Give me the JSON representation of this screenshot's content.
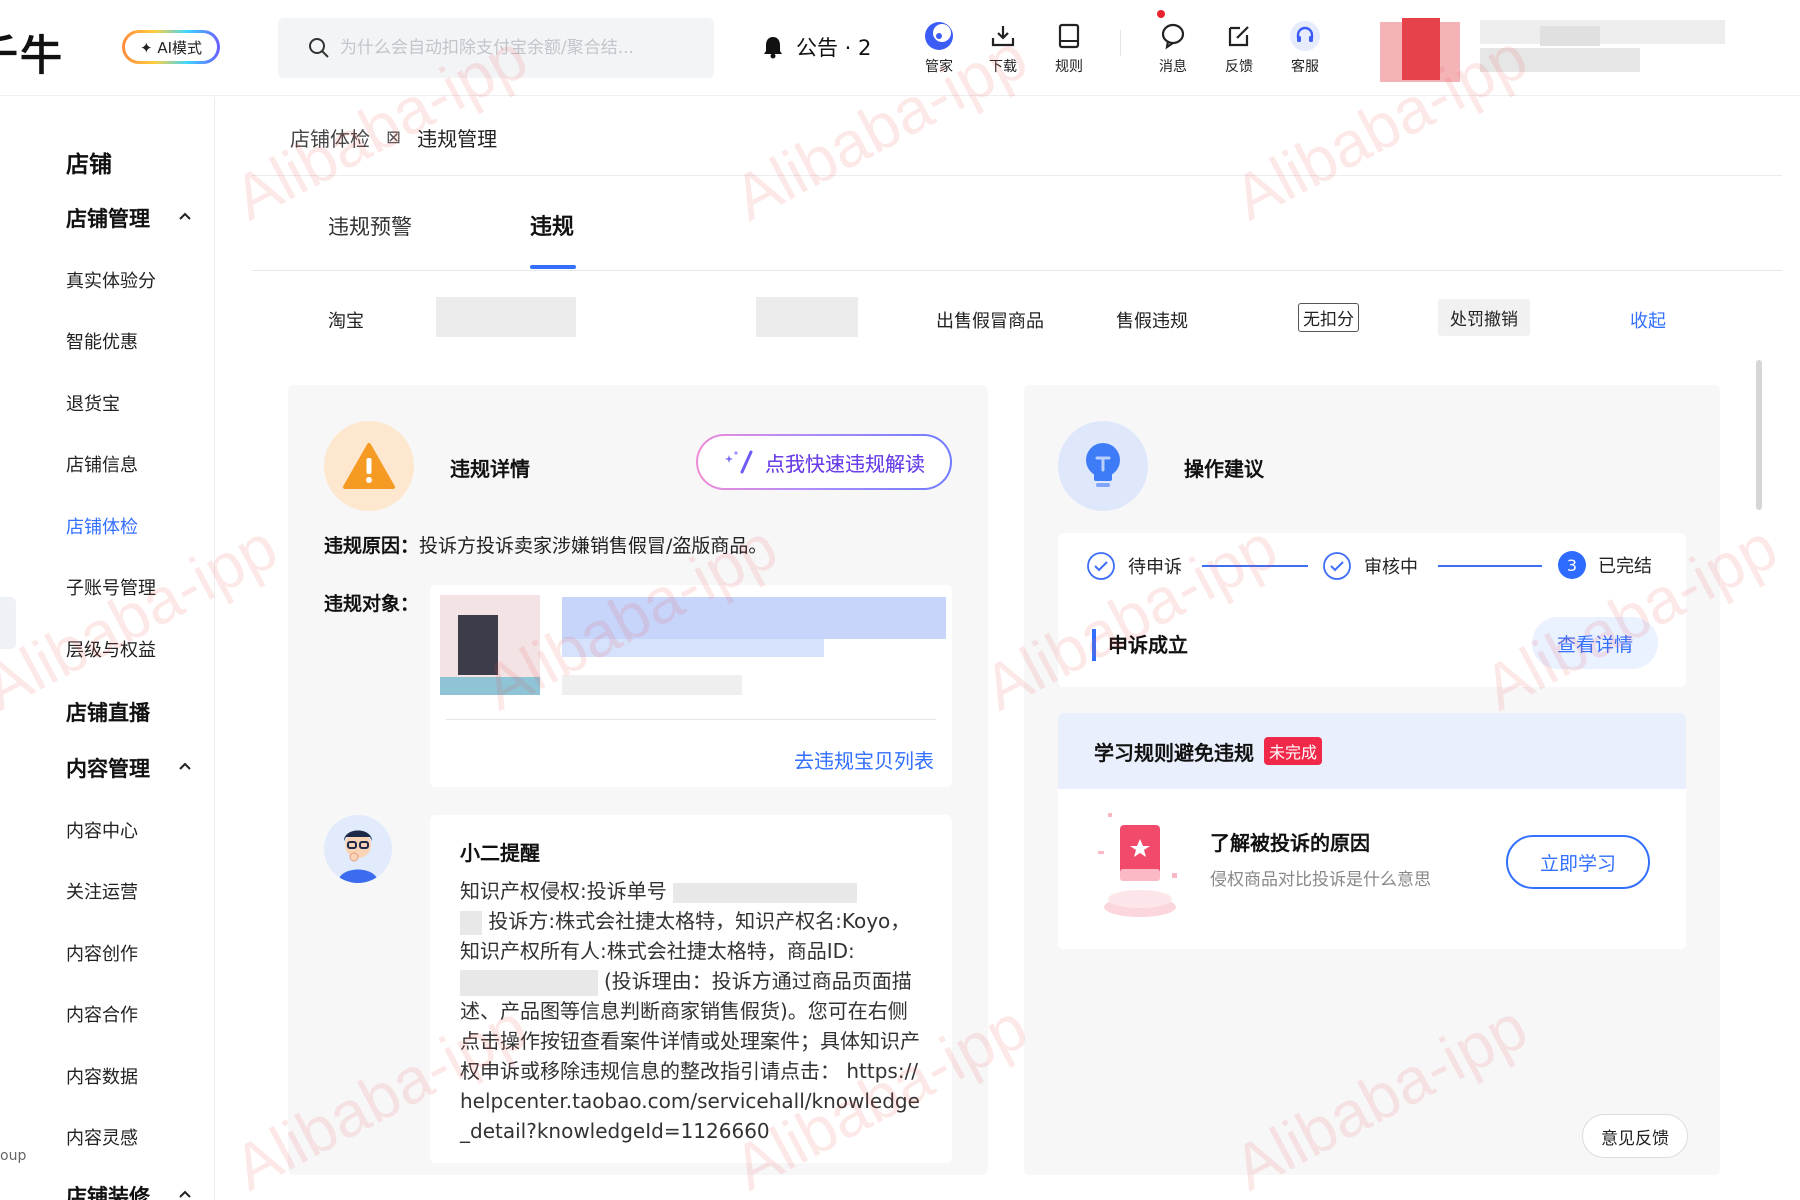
{
  "topbar": {
    "logo": "千牛",
    "ai_mode": "✦ AI模式",
    "search_placeholder": "为什么会自动扣除支付宝余额/聚合结...",
    "notice": "公告 · 2",
    "tools": [
      {
        "label": "管家",
        "icon": "butler-icon"
      },
      {
        "label": "下载",
        "icon": "download-icon"
      },
      {
        "label": "规则",
        "icon": "rules-icon"
      },
      {
        "label": "消息",
        "icon": "message-icon"
      },
      {
        "label": "反馈",
        "icon": "feedback-icon"
      },
      {
        "label": "客服",
        "icon": "headset-icon"
      }
    ]
  },
  "sidebar": {
    "header": "店铺",
    "groups": [
      {
        "label": "店铺管理",
        "items": [
          "真实体验分",
          "智能优惠",
          "退货宝",
          "店铺信息",
          "店铺体检",
          "子账号管理",
          "层级与权益"
        ]
      },
      {
        "label": "店铺直播"
      },
      {
        "label": "内容管理",
        "items": [
          "内容中心",
          "关注运营",
          "内容创作",
          "内容合作",
          "内容数据",
          "内容灵感"
        ]
      },
      {
        "label": "店铺装修"
      }
    ],
    "active_item": "店铺体检",
    "bottom_text": "oup"
  },
  "breadcrumb": {
    "parent": "店铺体检",
    "separator": "⊠",
    "current": "违规管理"
  },
  "tabs": {
    "items": [
      "违规预警",
      "违规"
    ],
    "active": "违规"
  },
  "summary": {
    "platform": "淘宝",
    "type": "出售假冒商品",
    "category": "售假违规",
    "points": "无扣分",
    "status": "处罚撤销",
    "collapse": "收起"
  },
  "violation": {
    "title": "违规详情",
    "ai_button": "点我快速违规解读",
    "reason_label": "违规原因：",
    "reason_text": "投诉方投诉卖家涉嫌销售假冒/盗版商品。",
    "target_label": "违规对象：",
    "goto_link": "去违规宝贝列表"
  },
  "reminder": {
    "title": "小二提醒",
    "line1": "知识产权侵权:投诉单号",
    "line2": "投诉方:株式会社捷太格特，知识产权名:Koyo，知识产权所有人:株式会社捷太格特，商品ID:",
    "line3": "(投诉理由：投诉方通过商品页面描述、产品图等信息判断商家销售假货)。您可在右侧点击操作按钮查看案件详情或处理案件；具体知识产权申诉或移除违规信息的整改指引请点击： https://helpcenter.taobao.com/servicehall/knowledge_detail?knowledgeId=1126660"
  },
  "advice": {
    "title": "操作建议",
    "steps": [
      "待申诉",
      "审核中",
      "已完结"
    ],
    "step3_num": "3",
    "appeal_result": "申诉成立",
    "detail_button": "查看详情"
  },
  "learn": {
    "title": "学习规则避免违规",
    "badge": "未完成",
    "item_title": "了解被投诉的原因",
    "item_sub": "侵权商品对比投诉是什么意思",
    "button": "立即学习"
  },
  "feedback_button": "意见反馈",
  "watermark": "Alibaba-ipp",
  "colors": {
    "accent": "#3370ff",
    "warning": "#f59a23",
    "danger": "#f0294a"
  }
}
